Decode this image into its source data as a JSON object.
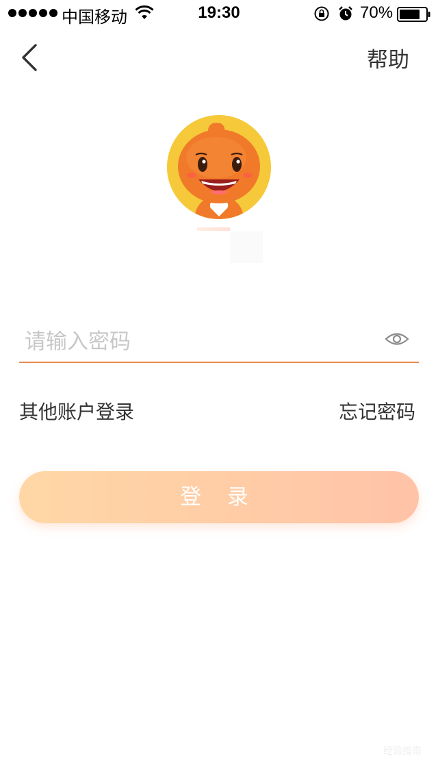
{
  "status_bar": {
    "carrier": "中国移动",
    "time": "19:30",
    "battery_percent": "70%"
  },
  "nav": {
    "help_label": "帮助"
  },
  "password": {
    "placeholder": "请输入密码",
    "value": ""
  },
  "links": {
    "other_account": "其他账户登录",
    "forgot_password": "忘记密码"
  },
  "login_button_label": "登 录",
  "watermark": "经验指南",
  "colors": {
    "accent": "#e98a4f",
    "avatar_bg": "#f5c93a",
    "button_gradient_start": "#ffd7a6",
    "button_gradient_end": "#ffc3a8"
  }
}
